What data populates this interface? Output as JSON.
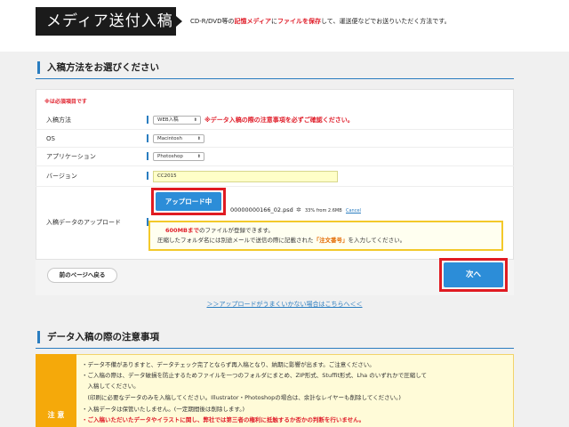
{
  "header": {
    "title": "メディア送付入稿",
    "desc_prefix": "CD-R/DVD等の",
    "desc_red1": "記憶メディア",
    "desc_mid": "に",
    "desc_red2": "ファイルを保存",
    "desc_suffix": "して、運送便などでお送りいただく方法です。"
  },
  "section1": {
    "heading": "入稿方法をお選びください",
    "required_note": "※は必須項目です",
    "rows": {
      "method": {
        "label": "入稿方法",
        "value": "WEB入稿",
        "warning": "※データ入稿の際の注意事項を必ずご確認ください。"
      },
      "os": {
        "label": "OS",
        "value": "Macintosh"
      },
      "application": {
        "label": "アプリケーション",
        "value": "Photoshop"
      },
      "version": {
        "label": "バージョン",
        "value": "CC2015"
      },
      "upload": {
        "label": "入稿データのアップロード",
        "button_label": "アップロード中",
        "file_name": "00000000166_02.psd",
        "progress_text": "33% from 2.6MB",
        "progress_percent": 33,
        "cancel_label": "Cancel"
      }
    },
    "info": {
      "line1_red": "600MBまで",
      "line1_rest": "のファイルが登録できます。",
      "line2_prefix": "圧縮したフォルダ名には別途メールで送信の際に記載された",
      "line2_orange": "「注文番号」",
      "line2_suffix": "を入力してください。"
    },
    "back_label": "前のページへ戻る",
    "next_label": "次へ"
  },
  "trouble_link": "＞＞アップロードがうまくいかない場合はこちらへ＜＜",
  "section2": {
    "heading": "データ入稿の際の注意事項",
    "side_label": "注 意",
    "notes": [
      "・データ不備がありますと、データチェック完了とならず再入稿となり、納期に影響が出ます。ご注意ください。",
      "・ご入稿の際は、データ破損を防止するためファイルを一つのフォルダにまとめ、ZIP形式、Stuffit形式、Lha のいずれかで圧縮して",
      "　入稿してください。",
      "　(印刷に必要なデータのみを入稿してください。Illustrator・Photoshopの場合は、余計なレイヤーも削除してください。)",
      "・入稿データは保管いたしません。(一定期間後は削除します。)",
      "・ご入稿いただいたデータやイラストに関し、弊社では第三者の権利に抵触するか否かの判断を行いません。"
    ]
  },
  "colors": {
    "accent_blue": "#2c8dd8",
    "highlight_red": "#e01b22",
    "notice_orange": "#f5a90a",
    "input_yellow": "#ffffc8"
  }
}
